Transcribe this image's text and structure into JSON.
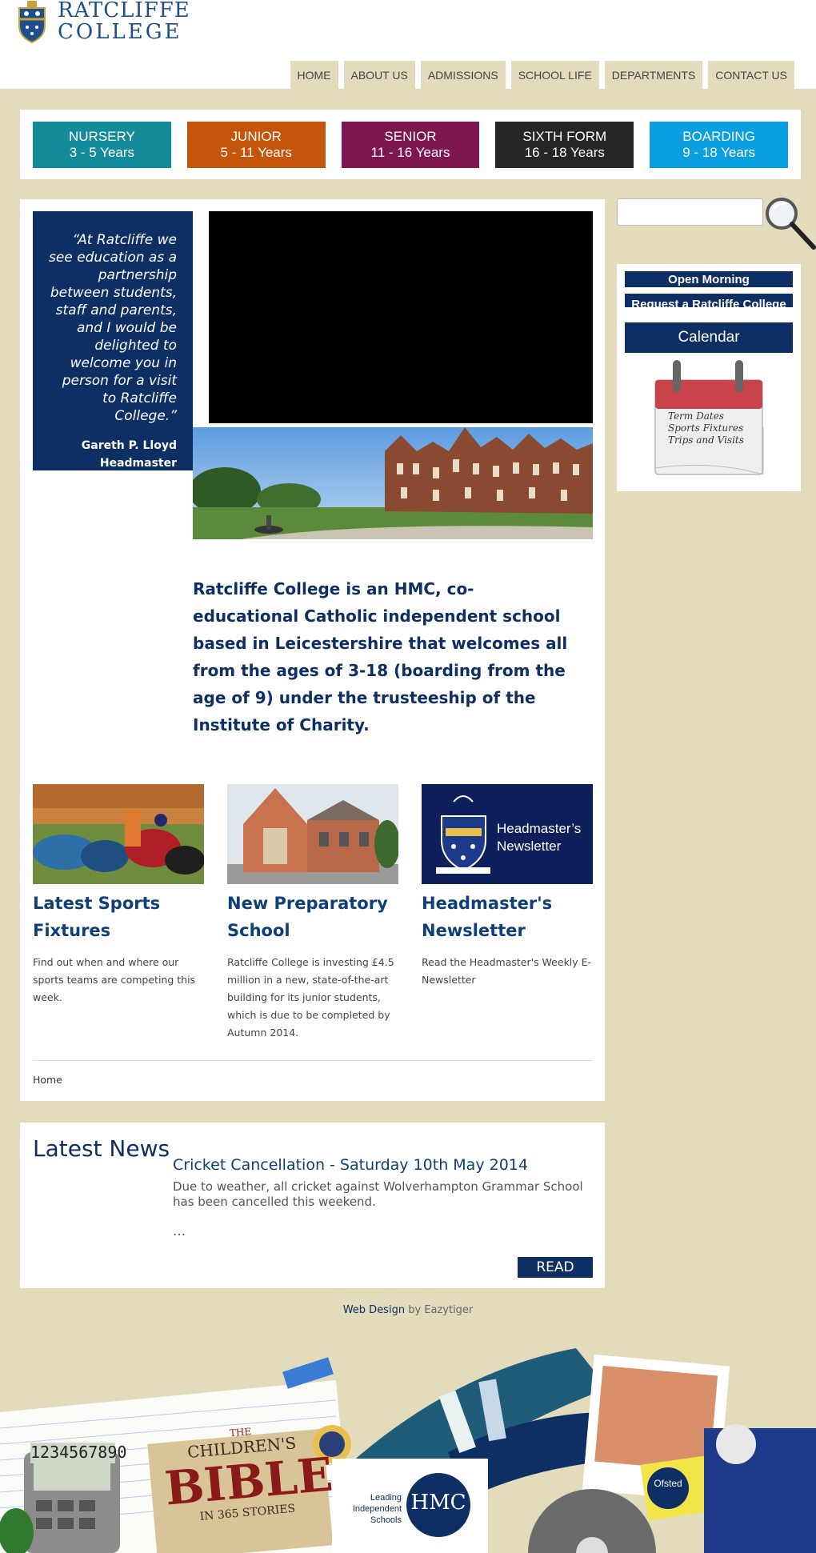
{
  "header": {
    "logo_line1": "RATCLIFFE",
    "logo_line2": "COLLEGE"
  },
  "nav": {
    "items": [
      "HOME",
      "ABOUT US",
      "ADMISSIONS",
      "SCHOOL LIFE",
      "DEPARTMENTS",
      "CONTACT US"
    ]
  },
  "stages": [
    {
      "name": "NURSERY",
      "ages": "3 - 5 Years",
      "color": "#148b9b"
    },
    {
      "name": "JUNIOR",
      "ages": "5 - 11 Years",
      "color": "#c4550b"
    },
    {
      "name": "SENIOR",
      "ages": "11 - 16 Years",
      "color": "#7e1650"
    },
    {
      "name": "SIXTH FORM",
      "ages": "16 - 18 Years",
      "color": "#262626"
    },
    {
      "name": "BOARDING",
      "ages": "9 - 18 Years",
      "color": "#0a9fe0"
    }
  ],
  "quote": {
    "text": "“At Ratcliffe we see education as a partnership between students, staff and parents, and I would be delighted to welcome you in person for a visit to Ratcliffe College.”",
    "author": "Gareth P. Lloyd",
    "role": "Headmaster"
  },
  "intro": "Ratcliffe College is an HMC, co-educational Catholic independent school based in Leicestershire that welcomes all from the ages of 3-18 (boarding from the age of 9) under the trusteeship of the Institute of Charity.",
  "cards": [
    {
      "title": "Latest Sports Fixtures",
      "desc": "Find out when and where our sports teams are competing this week."
    },
    {
      "title": "New Preparatory School",
      "desc": "Ratcliffe College is investing £4.5 million in a new, state-of-the-art building for its junior students, which is due to be completed by Autumn 2014."
    },
    {
      "title": "Headmaster's Newsletter",
      "desc": "Read the Headmaster's Weekly E-Newsletter",
      "thumb_text_1": "Headmaster’s",
      "thumb_text_2": "Newsletter"
    }
  ],
  "breadcrumb": "Home",
  "news": {
    "heading": "Latest News",
    "title": "Cricket Cancellation - Saturday 10th May 2014",
    "body": "Due to weather, all cricket against Wolverhampton Grammar School has been cancelled this weekend.",
    "ellipsis": "...",
    "read_label": "READ"
  },
  "footer": {
    "link": "Web Design",
    "suffix": " by Eazytiger"
  },
  "sidebar": {
    "open_morning": "Open Morning",
    "request": "Request a Ratcliffe College",
    "calendar": "Calendar",
    "calendar_notes": [
      "Term Dates",
      "Sports Fixtures",
      "Trips and Visits"
    ]
  },
  "collage": {
    "hmc_text": "Leading Independent Schools",
    "hmc_logo": "HMC",
    "bible_the": "THE",
    "bible_title1": "CHILDREN'S",
    "bible_title2": "BIBLE",
    "bible_sub": "IN 365 STORIES",
    "ofsted": "Ofsted"
  }
}
